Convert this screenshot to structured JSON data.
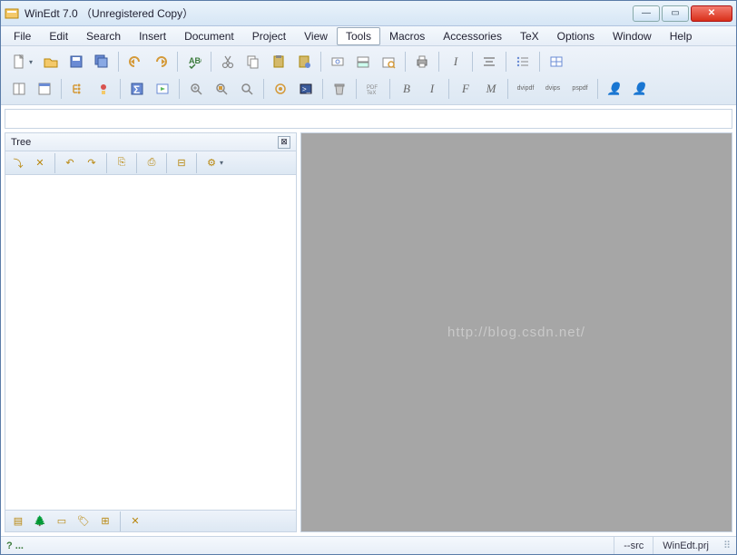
{
  "title": "WinEdt 7.0 （Unregistered  Copy）",
  "menu": [
    "File",
    "Edit",
    "Search",
    "Insert",
    "Document",
    "Project",
    "View",
    "Tools",
    "Macros",
    "Accessories",
    "TeX",
    "Options",
    "Window",
    "Help"
  ],
  "menu_active": "Tools",
  "toolbar_row1_icons": [
    "new-doc",
    "dd",
    "open",
    "save",
    "save-all",
    "sep",
    "undo",
    "redo",
    "sep",
    "spellcheck",
    "sep",
    "cut",
    "copy",
    "paste",
    "paste-special",
    "sep",
    "find",
    "replace",
    "find-in-files",
    "sep",
    "print",
    "sep",
    "italic",
    "sep",
    "align-center",
    "sep",
    "list",
    "sep",
    "table"
  ],
  "toolbar_row2_icons": [
    "window-split",
    "window-new",
    "sep",
    "tree-sync",
    "tree-config",
    "sep",
    "sigma",
    "run-macro",
    "sep",
    "zoom-in",
    "zoom-fit",
    "zoom-page",
    "sep",
    "execute",
    "console",
    "sep",
    "trash",
    "sep",
    "pdf-tex",
    "sep",
    "bold",
    "italic2",
    "sep",
    "font-f",
    "font-m",
    "sep",
    "dvi-pdf",
    "dvi-ps",
    "ps-pdf",
    "sep",
    "person1",
    "person2"
  ],
  "toolbar_labels": {
    "bold": "B",
    "italic2": "I",
    "font-f": "F",
    "font-m": "M",
    "dvi-pdf": "dvi\npdf",
    "dvi-ps": "dvi\nps",
    "ps-pdf": "ps\npdf",
    "italic": "I",
    "person1": "👤",
    "person2": "👤"
  },
  "tree": {
    "title": "Tree",
    "toolbar_icons": [
      "expand",
      "collapse-x",
      "sep",
      "branch-left",
      "branch-right",
      "sep",
      "copy-node",
      "sep",
      "paste-node",
      "sep",
      "collapse-all",
      "sep",
      "options",
      "dd"
    ],
    "footer_icons": [
      "view-list",
      "view-tree",
      "view-flat",
      "view-tags",
      "view-mixed",
      "sep",
      "close-x"
    ]
  },
  "watermark": "http://blog.csdn.net/",
  "status": {
    "left": "?  ...",
    "src": "--src",
    "project": "WinEdt.prj"
  }
}
